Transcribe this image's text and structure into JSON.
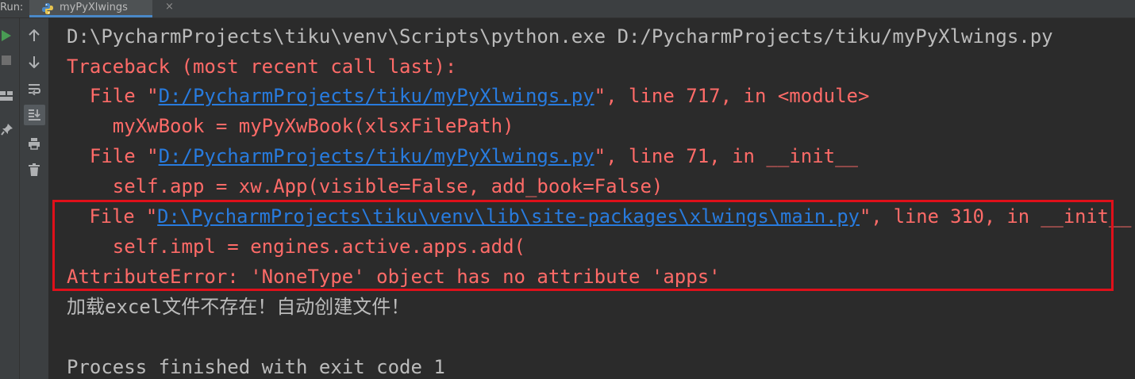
{
  "run_panel": {
    "label": "Run:",
    "tab_title": "myPyXlwings",
    "tab_close": "×"
  },
  "toolbar": {
    "outer_icons": [
      "play-icon",
      "stop-icon",
      "layout-icon",
      "pin-icon"
    ],
    "inner_icons": [
      "arrow-up-icon",
      "arrow-down-icon",
      "soft-wrap-icon",
      "scroll-to-end-icon",
      "print-icon",
      "trash-icon"
    ]
  },
  "console": {
    "command": "D:\\PycharmProjects\\tiku\\venv\\Scripts\\python.exe D:/PycharmProjects/tiku/myPyXlwings.py",
    "traceback_header": "Traceback (most recent call last):",
    "frames": [
      {
        "prefix": "  File \"",
        "path": "D:/PycharmProjects/tiku/myPyXlwings.py",
        "suffix": "\", line 717, in <module>",
        "code": "    myXwBook = myPyXwBook(xlsxFilePath)"
      },
      {
        "prefix": "  File \"",
        "path": "D:/PycharmProjects/tiku/myPyXlwings.py",
        "suffix": "\", line 71, in __init__",
        "code": "    self.app = xw.App(visible=False, add_book=False)"
      },
      {
        "prefix": "  File \"",
        "path": "D:\\PycharmProjects\\tiku\\venv\\lib\\site-packages\\xlwings\\main.py",
        "suffix": "\", line 310, in __init__",
        "code": "    self.impl = engines.active.apps.add("
      }
    ],
    "error": "AttributeError: 'NoneType' object has no attribute 'apps'",
    "message": "加载excel文件不存在！自动创建文件！",
    "exit": "Process finished with exit code 1"
  },
  "colors": {
    "background": "#2b2b2b",
    "toolbar": "#3c3f41",
    "error_text": "#ff6b68",
    "plain_text": "#bbbbbb",
    "link": "#287bde",
    "highlight_border": "#e0101a",
    "run_green": "#499c54"
  }
}
